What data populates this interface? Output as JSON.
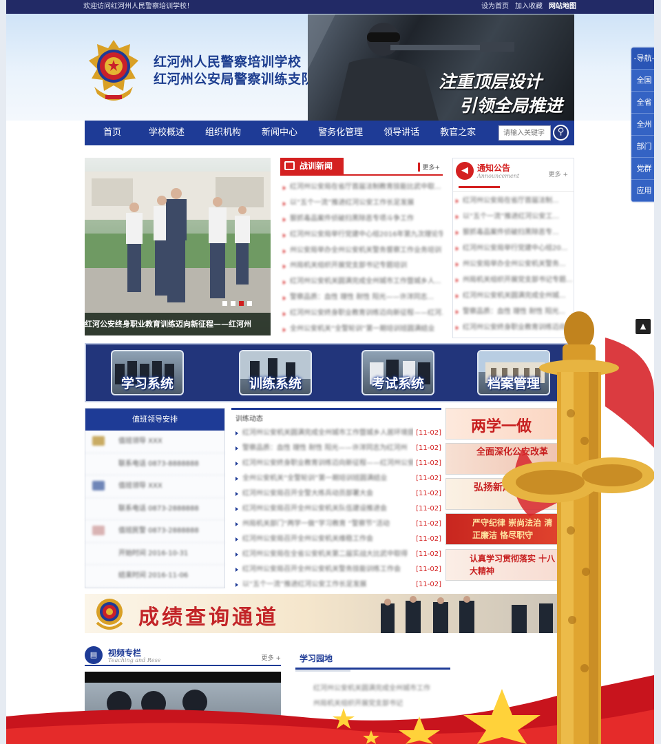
{
  "topbar": {
    "welcome": "欢迎访问红河州人民警察培训学校！",
    "links": [
      "设为首页",
      "加入收藏",
      "网站地图"
    ]
  },
  "header": {
    "title_line1": "红河州人民警察培训学校",
    "title_line2": "红河州公安局警察训练支队",
    "banner_slogan_1": "注重顶层设计",
    "banner_slogan_2": "引领全局推进"
  },
  "nav": {
    "items": [
      "首页",
      "学校概述",
      "组织机构",
      "新闻中心",
      "警务化管理",
      "领导讲话",
      "教官之家"
    ],
    "search_placeholder": "请输入关键字"
  },
  "slideshow": {
    "caption": "红河公安终身职业教育训练迈向新征程——红河州",
    "active_dot": 3,
    "dot_count": 4
  },
  "news": {
    "title": "战训新闻",
    "more": "更多+",
    "items": [
      "红河州公安局在省厅首届法制教育技能比武中取...",
      "以“五个一流”推进红河公安工作长足发展",
      "狠抓毒品案件侦破扫黑除恶专项斗争工作",
      "红河州公安局举行党建中心组2016年第九次理论学",
      "州公安局举办全州公安机关警务督察工作业务培训",
      "州局机关组织开展党支部书记专题培训",
      "红河州公安机关圆满完成全州城市工作暨城乡人...",
      "警察品质：血性 理性 耐性 阳光——许洋同志...",
      "红河州公安终身职业教育训练迈向新征程——红河...",
      "全州公安机关“全警轮训”第一期培训班圆满结业"
    ]
  },
  "notice": {
    "title": "通知公告",
    "subtitle": "Announcement",
    "more": "更多 +",
    "items": [
      "红河州公安局在省厅首届法制...",
      "以“五个一流”推进红河公安工...",
      "狠抓毒品案件侦破扫黑除恶专...",
      "红河州公安局举行党建中心组20...",
      "州公安局举办全州公安机关警务...",
      "州局机关组织开展党支部书记专题...",
      "红河州公安机关圆满完成全州城...",
      "警察品质：血性 理性 耐性 阳光...",
      "红河州公安终身职业教育训练迈向..."
    ]
  },
  "systems": [
    "学习系统",
    "训练系统",
    "考试系统",
    "档案管理"
  ],
  "duty": {
    "title": "值班领导安排",
    "rows": [
      "值班领导 XXX",
      "联系电话 0873-8888888",
      "值班领导 XXX",
      "联系电话 0873-2888888",
      "值班民警 0873-2888888",
      "开始时间 2016-10-31",
      "结束时间 2016-11-06"
    ]
  },
  "train": {
    "title": "训练动态",
    "items": [
      {
        "text": "红河州公安机关圆满完成全州城市工作暨城乡人居环境提",
        "date": "[11-02]"
      },
      {
        "text": "警察品质：血性 理性 耐性 阳光——许洋同志为红河州",
        "date": "[11-02]"
      },
      {
        "text": "红河州公安终身职业教育训练迈向新征程——红河州公安机",
        "date": "[11-02]"
      },
      {
        "text": "全州公安机关“全警轮训”第一期培训班圆满结业",
        "date": "[11-02]"
      },
      {
        "text": "红河州公安局召开全警大练兵动员部署大会",
        "date": "[11-02]"
      },
      {
        "text": "红河州公安局召开全州公安机关队伍建设推进会",
        "date": "[11-02]"
      },
      {
        "text": "州局机关部门“两学一做”学习教育 “警察节”活动",
        "date": "[11-02]"
      },
      {
        "text": "红河州公安局召开全州公安机关维稳工作会",
        "date": "[11-02]"
      },
      {
        "text": "红河州公安局在全省公安机关第二届实战大比武中取得",
        "date": "[11-02]"
      },
      {
        "text": "红河州公安局召开全州公安机关警务技能训练工作会",
        "date": "[11-02]"
      },
      {
        "text": "以“五个一流”推进红河公安工作长足发展",
        "date": "[11-02]"
      }
    ]
  },
  "promos": [
    "两学一做",
    "全面深化公安改革",
    "弘扬新风 树立正气",
    "严守纪律 崇尚法治 清正廉洁 恪尽职守",
    "认真学习贯彻落实 十八大精神"
  ],
  "scores_banner": "成绩查询通道",
  "video": {
    "title": "视频专栏",
    "subtitle": "Teaching and Rese",
    "more": "更多 +"
  },
  "study": {
    "title": "学习园地",
    "items": [
      "红河州公安机关圆满完成全州城市工作",
      "州局机关组织开展党支部书记"
    ]
  },
  "sidenav": [
    "-导航-",
    "全国",
    "全省",
    "全州",
    "部门",
    "党群",
    "应用"
  ],
  "colors": {
    "brand_blue": "#1e3b96",
    "accent_red": "#d42121",
    "topbar": "#222a66",
    "gold": "#d9a025"
  }
}
